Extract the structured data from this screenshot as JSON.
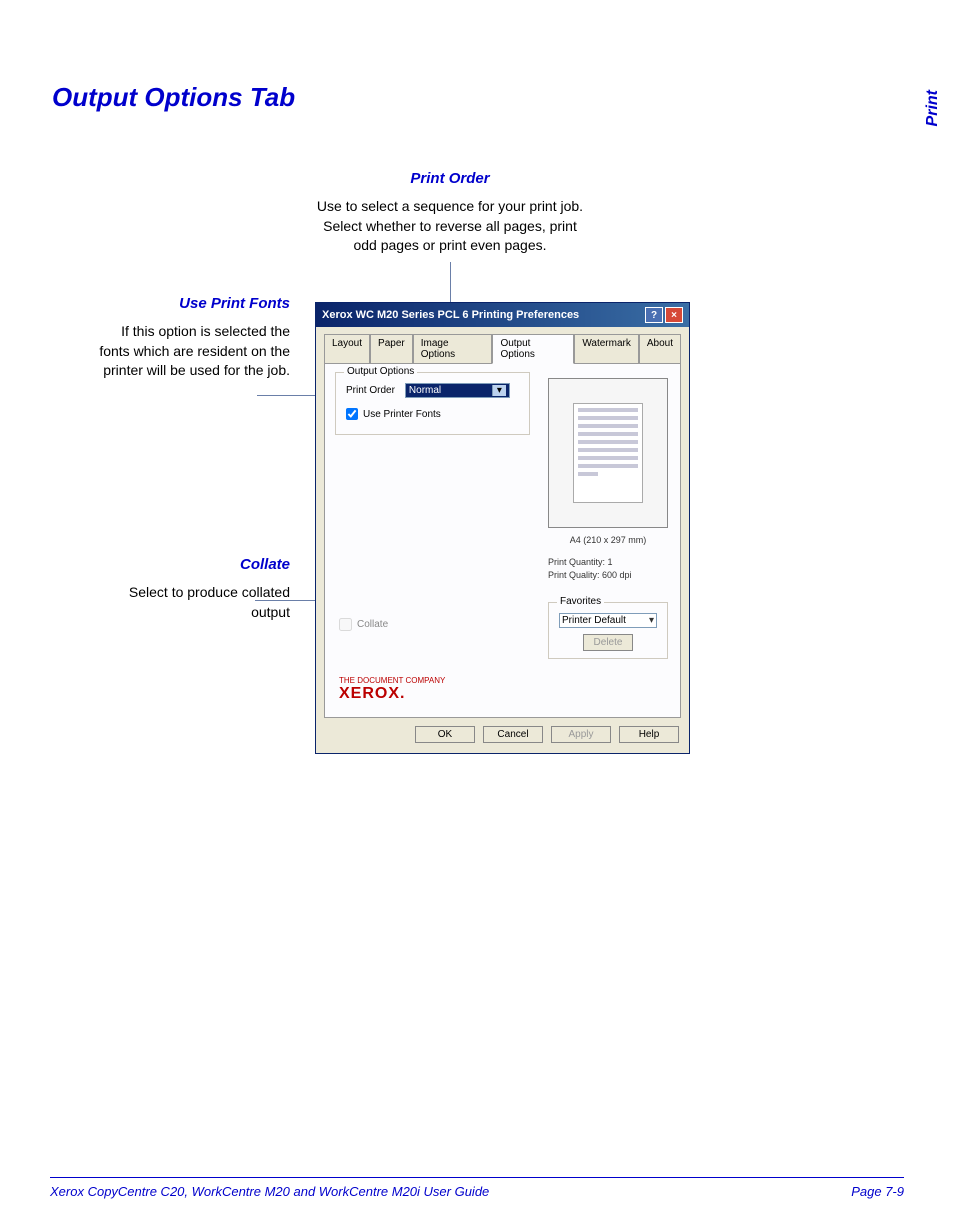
{
  "page": {
    "title": "Output Options Tab",
    "side_label": "Print"
  },
  "callouts": {
    "print_order": {
      "header": "Print Order",
      "text": "Use to select a sequence for your print job. Select whether to reverse all pages, print odd pages or print even pages."
    },
    "use_print_fonts": {
      "header": "Use Print Fonts",
      "text": "If this option is selected the fonts which are resident on the printer will be used for the job."
    },
    "collate": {
      "header": "Collate",
      "text": "Select to produce collated output"
    }
  },
  "dialog": {
    "title": "Xerox WC M20 Series PCL 6 Printing Preferences",
    "tabs": [
      "Layout",
      "Paper",
      "Image Options",
      "Output Options",
      "Watermark",
      "About"
    ],
    "active_tab": "Output Options",
    "output_options_legend": "Output Options",
    "print_order_label": "Print Order",
    "print_order_value": "Normal",
    "use_printer_fonts_label": "Use Printer Fonts",
    "use_printer_fonts_checked": true,
    "collate_label": "Collate",
    "collate_checked": false,
    "preview": {
      "paper_info": "A4 (210 x 297 mm)",
      "quantity": "Print Quantity: 1",
      "quality": "Print Quality: 600 dpi"
    },
    "favorites": {
      "legend": "Favorites",
      "selected": "Printer Default",
      "delete_label": "Delete"
    },
    "brand_tagline": "THE DOCUMENT COMPANY",
    "brand_name": "XEROX.",
    "buttons": {
      "ok": "OK",
      "cancel": "Cancel",
      "apply": "Apply",
      "help": "Help"
    }
  },
  "footer": {
    "left": "Xerox CopyCentre C20, WorkCentre M20 and WorkCentre M20i User Guide",
    "right": "Page 7-9"
  }
}
